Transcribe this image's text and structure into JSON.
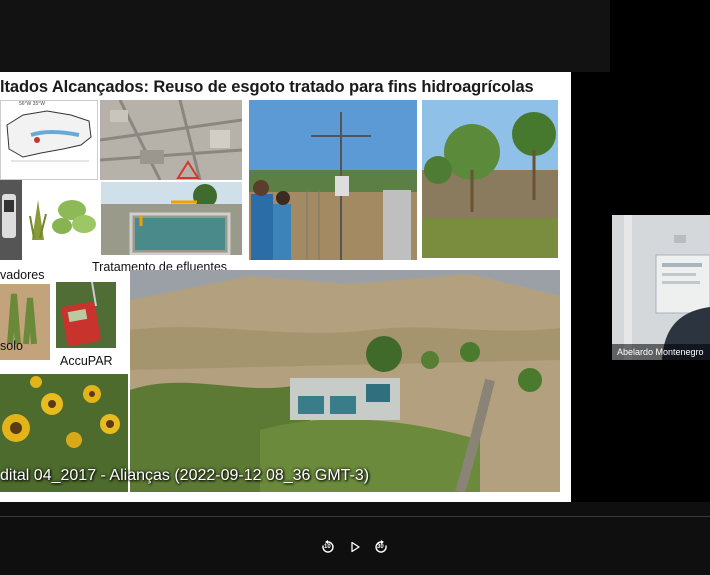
{
  "slide": {
    "title": "ltados Alcançados:  Reuso de esgoto tratado para fins hidroagrícolas",
    "captions": {
      "tratamento": "Tratamento de efluentes",
      "sensores": "vadores",
      "solo": "solo",
      "accupar": "AccuPAR"
    },
    "map_scale": "56°W  35°W"
  },
  "video_overlay": {
    "text": "dital 04_2017 - Alianças  (2022-09-12 08_36 GMT-3)"
  },
  "participant": {
    "name": "Abelardo Montenegro"
  },
  "player_controls": {
    "rewind_seconds": "10",
    "forward_seconds": "30"
  }
}
